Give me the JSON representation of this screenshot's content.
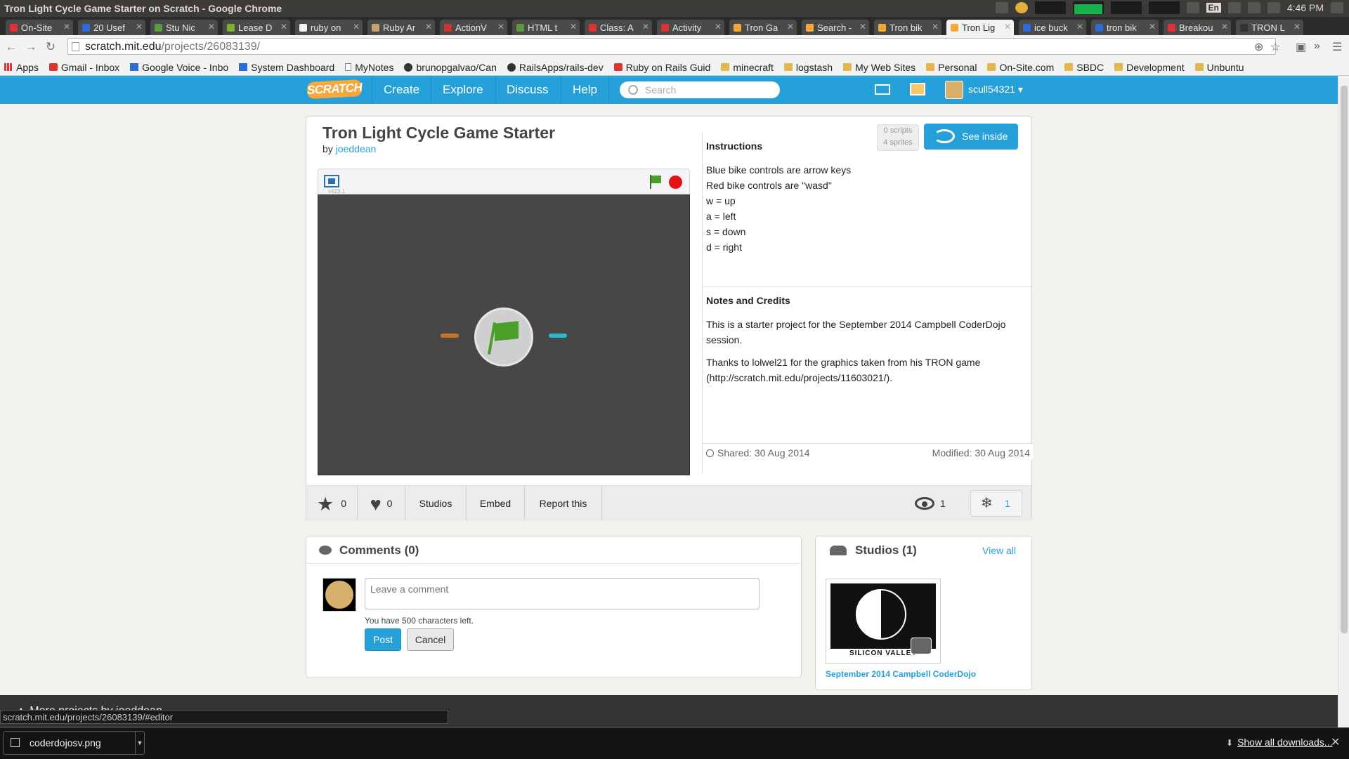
{
  "window": {
    "title": "Tron Light Cycle Game Starter on Scratch - Google Chrome",
    "clock": "4:46 PM",
    "lang": "En"
  },
  "tabs": [
    {
      "label": "On-Site",
      "color": "#d33"
    },
    {
      "label": "20 Usef",
      "color": "#2d6bd6"
    },
    {
      "label": "Stu Nic",
      "color": "#5a9c3c"
    },
    {
      "label": "Lease D",
      "color": "#7bb32e"
    },
    {
      "label": "ruby on",
      "color": "#f2f2f2"
    },
    {
      "label": "Ruby Ar",
      "color": "#c9a36b"
    },
    {
      "label": "ActionV",
      "color": "#c33"
    },
    {
      "label": "HTML t",
      "color": "#5a9c3c"
    },
    {
      "label": "Class: A",
      "color": "#d33"
    },
    {
      "label": "Activity",
      "color": "#d33"
    },
    {
      "label": "Tron Ga",
      "color": "#f9a73a"
    },
    {
      "label": "Search -",
      "color": "#f9a73a"
    },
    {
      "label": "Tron bik",
      "color": "#f9a73a"
    },
    {
      "label": "Tron Lig",
      "color": "#f9a73a",
      "active": true
    },
    {
      "label": "ice buck",
      "color": "#2d6bd6"
    },
    {
      "label": "tron bik",
      "color": "#2d6bd6"
    },
    {
      "label": "Breakou",
      "color": "#d33"
    },
    {
      "label": "TRON L",
      "color": "#333"
    }
  ],
  "omnibox": {
    "host": "scratch.mit.edu",
    "path": "/projects/26083139/"
  },
  "bookmarks": [
    {
      "label": "Apps",
      "icon": "grid"
    },
    {
      "label": "Gmail - Inbox",
      "icon": "red"
    },
    {
      "label": "Google Voice - Inbo",
      "icon": "blue"
    },
    {
      "label": "System Dashboard",
      "icon": "blue"
    },
    {
      "label": "MyNotes",
      "icon": "page"
    },
    {
      "label": "brunopgalvao/Can",
      "icon": "gh"
    },
    {
      "label": "RailsApps/rails-dev",
      "icon": "gh"
    },
    {
      "label": "Ruby on Rails Guid",
      "icon": "red"
    },
    {
      "label": "minecraft",
      "icon": "folder"
    },
    {
      "label": "logstash",
      "icon": "folder"
    },
    {
      "label": "My Web Sites",
      "icon": "folder"
    },
    {
      "label": "Personal",
      "icon": "folder"
    },
    {
      "label": "On-Site.com",
      "icon": "folder"
    },
    {
      "label": "SBDC",
      "icon": "folder"
    },
    {
      "label": "Development",
      "icon": "folder"
    },
    {
      "label": "Unbuntu",
      "icon": "folder"
    }
  ],
  "scratch_nav": {
    "logo": "SCRATCH",
    "links": [
      "Create",
      "Explore",
      "Discuss",
      "Help"
    ],
    "search_placeholder": "Search",
    "username": "scull54321"
  },
  "project": {
    "title": "Tron Light Cycle Game Starter",
    "by_label": "by",
    "author": "joeddean",
    "scripts": "0 scripts",
    "sprites": "4 sprites",
    "see_inside": "See inside",
    "version": "v423.1",
    "instructions_heading": "Instructions",
    "instructions": [
      "Blue bike controls are arrow keys",
      "Red bike controls are \"wasd\"",
      "w = up",
      "a = left",
      "s = down",
      "d = right"
    ],
    "notes_heading": "Notes and Credits",
    "notes": [
      "This is a starter project for the September 2014 Campbell CoderDojo session.",
      "Thanks to lolwel21 for the graphics taken from his TRON game (http://scratch.mit.edu/projects/11603021/)."
    ],
    "shared": "Shared: 30 Aug 2014",
    "modified": "Modified: 30 Aug 2014",
    "favorites": "0",
    "loves": "0",
    "studios_label": "Studios",
    "embed_label": "Embed",
    "report_label": "Report this",
    "views": "1",
    "remixes": "1"
  },
  "comments": {
    "heading": "Comments (0)",
    "placeholder": "Leave a comment",
    "chars_left": "You have 500 characters left.",
    "post": "Post",
    "cancel": "Cancel"
  },
  "studios": {
    "heading": "Studios (1)",
    "view_all": "View all",
    "thumb_text": "SILICON VALLEY",
    "studio_name": "September 2014 Campbell CoderDojo"
  },
  "footer": {
    "more_projects": "More projects by joeddean",
    "status_url": "scratch.mit.edu/projects/26083139/#editor",
    "download_file": "coderdojosv.png",
    "show_all": "Show all downloads..."
  }
}
